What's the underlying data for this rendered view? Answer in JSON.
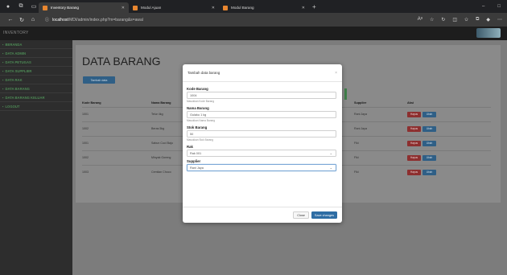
{
  "browser": {
    "tabs": [
      {
        "label": "Inventory Barang"
      },
      {
        "label": "Modul Ajuan"
      },
      {
        "label": "Modul Barang"
      }
    ],
    "url_host": "localhost",
    "url_path": "/MDI/admin/index.php?m=barang&s=awal"
  },
  "app": {
    "brand": "INVENTORY",
    "page_title": "DATA BARANG",
    "add_button": "Tambah data"
  },
  "sidebar": {
    "items": [
      {
        "label": "BERANDA"
      },
      {
        "label": "DATA ADMIN"
      },
      {
        "label": "DATA PETUGAS"
      },
      {
        "label": "DATA SUPPLIER"
      },
      {
        "label": "DATA RAK"
      },
      {
        "label": "DATA BARANG"
      },
      {
        "label": "DATA BARANG KELUAR"
      },
      {
        "label": "LOGOUT"
      }
    ]
  },
  "table": {
    "headers": [
      "Kode Barang",
      "Nama Barang",
      "Supplier",
      "Aksi"
    ],
    "rows": [
      {
        "kode": "1001",
        "nama": "Telur 4kg",
        "supplier": "Rani Jaya"
      },
      {
        "kode": "1002",
        "nama": "Beras 5kg",
        "supplier": "Rani Jaya"
      },
      {
        "kode": "1001",
        "nama": "Sabun Cuci Baju",
        "supplier": "Fiki"
      },
      {
        "kode": "1002",
        "nama": "Minyak Goreng",
        "supplier": "Fiki"
      },
      {
        "kode": "1003",
        "nama": "Cemilan Choco",
        "supplier": "Fiki"
      }
    ],
    "delete_label": "Hapus",
    "edit_label": "Ubah"
  },
  "modal": {
    "title": "Tambah data barang",
    "fields": {
      "kode_label": "Kode Barang",
      "kode_value": "1004",
      "kode_help": "Masukkan Kode Barang",
      "nama_label": "Nama Barang",
      "nama_value": "Gulaku 1 kg",
      "nama_help": "Masukkan Nama Barang",
      "stok_label": "Stok Barang",
      "stok_value": "50",
      "stok_help": "Masukkan Stok Barang",
      "rak_label": "Rak",
      "rak_value": "Rak 001",
      "supplier_label": "Supplier",
      "supplier_value": "Rani Jaya"
    },
    "close_button": "Close",
    "save_button": "Save changes"
  }
}
